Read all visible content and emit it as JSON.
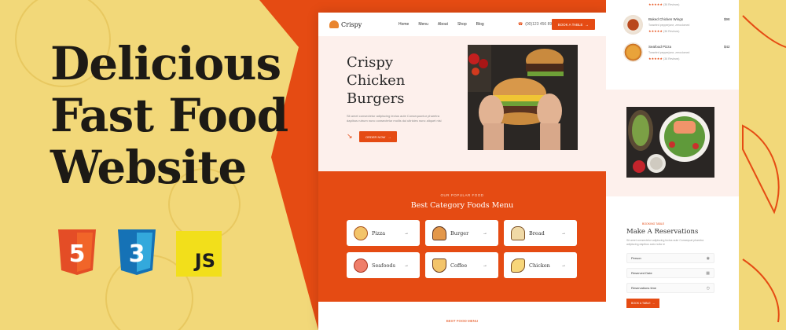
{
  "headline": {
    "line1": "Delicious",
    "line2": "Fast Food",
    "line3": "Website"
  },
  "badges": {
    "html": "5",
    "css": "3",
    "js": "JS"
  },
  "colors": {
    "accent": "#e54b13",
    "background": "#f2d879",
    "hero": "#fdf0ec"
  },
  "site": {
    "logo": "Crispy",
    "nav": [
      "Home",
      "Menu",
      "About",
      "Shop",
      "Blog"
    ],
    "phone": "(00)123 456 89",
    "book_button": "BOOK A TABLE",
    "hero": {
      "title_line1": "Crispy",
      "title_line2": "Chicken",
      "title_line3": "Burgers",
      "description": "Sit amet consectetur adipiscing lectus aute Consequuntur pharetra dapibus rutrum nunc consectetur mollis dui ultricies nunc aliquet nisi",
      "order_button": "ORDER NOW"
    },
    "category": {
      "subtitle": "OUR POPULAR FOOD",
      "title": "Best Category Foods Menu",
      "items": [
        {
          "label": "Pizza",
          "icon": "pizza-icon"
        },
        {
          "label": "Burger",
          "icon": "burger-icon"
        },
        {
          "label": "Bread",
          "icon": "bread-icon"
        },
        {
          "label": "Seafoods",
          "icon": "octopus-icon"
        },
        {
          "label": "Coffee",
          "icon": "coffee-icon"
        },
        {
          "label": "Chicken",
          "icon": "chicken-icon"
        }
      ]
    },
    "best_food": {
      "subtitle": "BEST FOOD MENU"
    }
  },
  "panel": {
    "menu": [
      {
        "name": "Baked Chicken Wings",
        "price": "$98",
        "desc": "Tosseled pepperjone, zeroclomed",
        "reviews": "(36 Reviews)"
      },
      {
        "name": "Seafood Pizza",
        "price": "$42",
        "desc": "Tosseled pepperjone, zeroclomed",
        "reviews": "(36 Reviews)"
      }
    ],
    "top_reviews": "(36 Reviews)",
    "reservation": {
      "subtitle": "BOOKING TABLE",
      "title": "Make A Reservations",
      "description": "Sit amet consectetur adipiscing lectus aute Consequat pharetra adipiscing dapibus auto nulla re",
      "fields": [
        "Person",
        "Reserved Date",
        "Reservations time"
      ],
      "button": "BOOK A TABLE"
    }
  }
}
